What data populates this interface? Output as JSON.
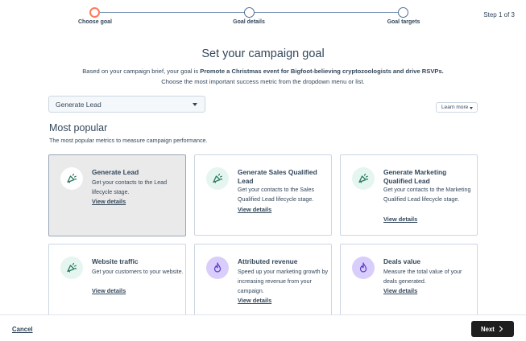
{
  "stepper": {
    "steps": [
      {
        "label": "Choose goal",
        "state": "active"
      },
      {
        "label": "Goal details",
        "state": "upcoming"
      },
      {
        "label": "Goal targets",
        "state": "upcoming"
      }
    ],
    "count_label": "Step 1 of 3"
  },
  "header": {
    "title": "Set your campaign goal",
    "brief_prefix": "Based on your campaign brief, your goal is ",
    "brief_goal": "Promote a Christmas event for Bigfoot-believing cryptozoologists and drive RSVPs.",
    "brief_sub": "Choose the most important success metric from the dropdown menu or list."
  },
  "dropdown": {
    "selected": "Generate Lead"
  },
  "learn_more": {
    "label": "Learn more"
  },
  "section": {
    "title": "Most popular",
    "subtitle": "The most popular metrics to measure campaign performance."
  },
  "cards": [
    {
      "title": "Generate Lead",
      "desc": "Get your contacts to the Lead lifecycle stage.",
      "link": "View details",
      "icon": "megaphone-icon",
      "selected": true
    },
    {
      "title": "Generate Sales Qualified Lead",
      "desc": "Get your contacts to the Sales Qualified Lead lifecycle stage.",
      "link": "View details",
      "icon": "megaphone-icon",
      "selected": false
    },
    {
      "title": "Generate Marketing Qualified Lead",
      "desc": "Get your contacts to the Marketing Qualified Lead lifecycle stage.",
      "link": "View details",
      "icon": "megaphone-icon",
      "selected": false
    },
    {
      "title": "Website traffic",
      "desc": "Get your customers to your website.",
      "link": "View details",
      "icon": "megaphone-icon",
      "selected": false
    },
    {
      "title": "Attributed revenue",
      "desc": "Speed up your marketing growth by increasing revenue from your campaign.",
      "link": "View details",
      "icon": "flame-icon",
      "selected": false
    },
    {
      "title": "Deals value",
      "desc": "Measure the total value of your deals generated.",
      "link": "View details",
      "icon": "flame-icon",
      "selected": false
    }
  ],
  "footer": {
    "cancel_label": "Cancel",
    "next_label": "Next"
  },
  "colors": {
    "accent": "#ff7a59",
    "text": "#33475b",
    "green_icon": "#2d7a5f",
    "purple_icon": "#5b3fc7",
    "next_bg": "#1f1f1f"
  }
}
